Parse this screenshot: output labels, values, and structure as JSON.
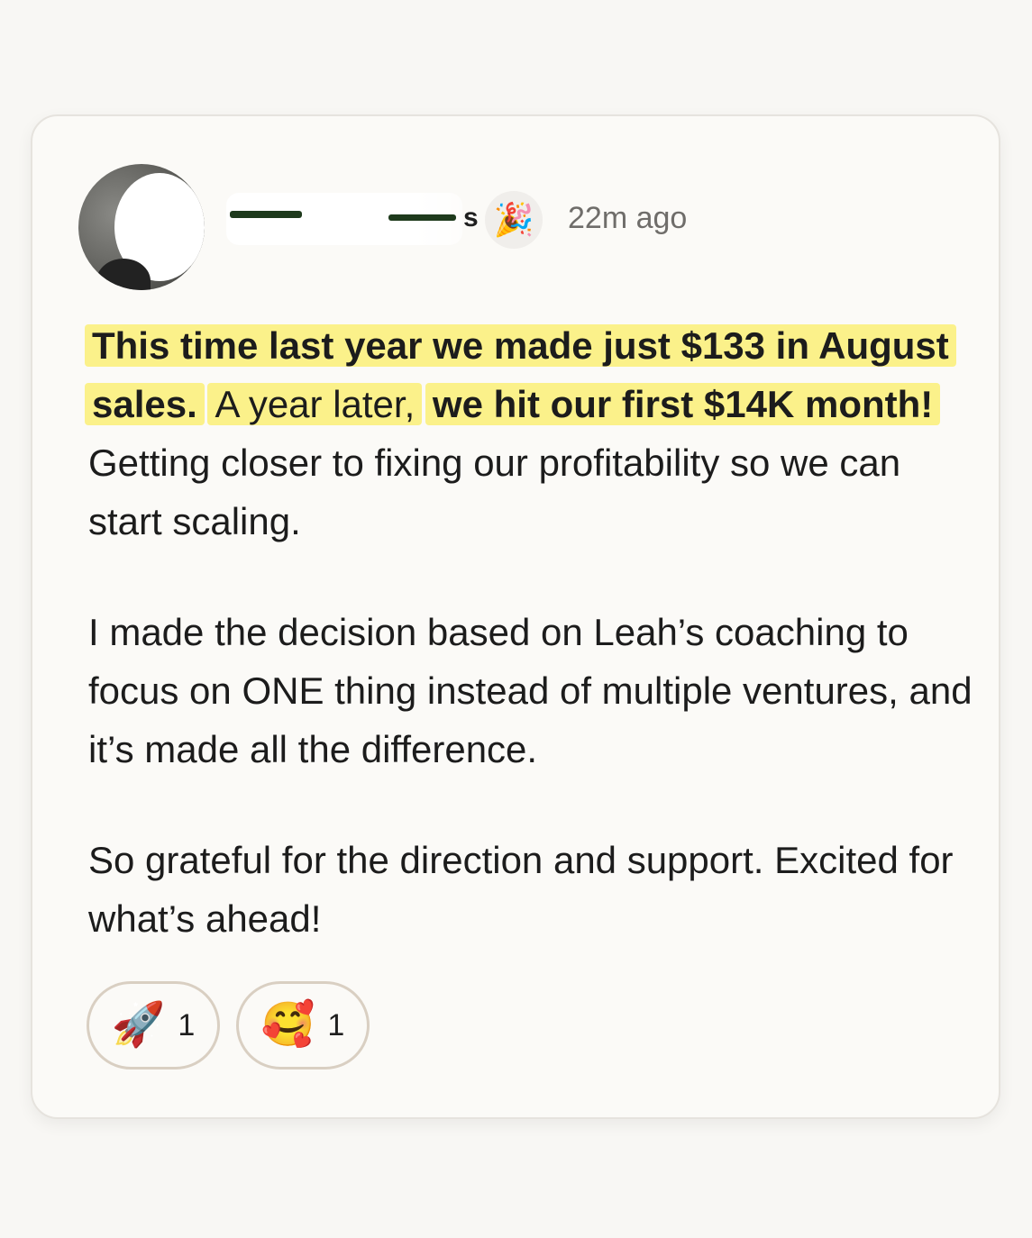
{
  "post": {
    "author_suffix": "s",
    "badge_emoji": "🎉",
    "timestamp": "22m ago",
    "paragraph1": {
      "hl1": "This time last year we made just $133 in August sales.",
      "mid": "A year later,",
      "hl2": "we hit our first $14K month!",
      "rest": " Getting closer to fixing our profitability so we can start scaling."
    },
    "paragraph2": "I made the decision based on Leah’s coaching to focus on ONE thing instead of multiple ventures, and it’s made all the difference.",
    "paragraph3": "So grateful for the direction and support. Excited for what’s ahead!"
  },
  "reactions": [
    {
      "emoji": "🚀",
      "count": "1"
    },
    {
      "emoji": "🥰",
      "count": "1"
    }
  ],
  "colors": {
    "highlight": "#fbf18a",
    "card_border": "#e6e3de",
    "reaction_border": "#d9cfc2"
  }
}
